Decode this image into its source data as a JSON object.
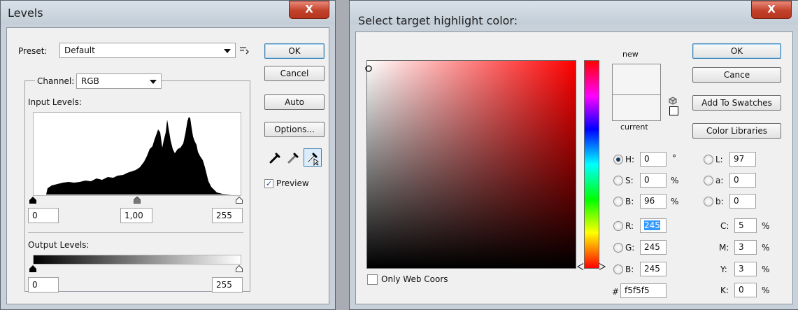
{
  "levels": {
    "title": "Levels",
    "close": "X",
    "preset_label": "Preset:",
    "preset_value": "Default",
    "channel_label": "Channel:",
    "channel_value": "RGB",
    "input_levels_label": "Input Levels:",
    "input_black": "0",
    "input_gamma": "1,00",
    "input_white": "255",
    "output_levels_label": "Output Levels:",
    "output_black": "0",
    "output_white": "255",
    "ok": "OK",
    "cancel": "Cancel",
    "auto": "Auto",
    "options": "Options...",
    "preview_label": "Preview",
    "preview_checked": true
  },
  "picker": {
    "title": "Select target highlight color:",
    "close": "X",
    "new_label": "new",
    "current_label": "current",
    "ok": "OK",
    "cancel": "Cance",
    "add_swatches": "Add To Swatches",
    "color_libraries": "Color Libraries",
    "h_label": "H:",
    "h_value": "0",
    "h_unit": "°",
    "s_label": "S:",
    "s_value": "0",
    "s_unit": "%",
    "b_label": "B:",
    "b_value": "96",
    "b_unit": "%",
    "r_label": "R:",
    "r_value": "245",
    "g_label": "G:",
    "g_value": "245",
    "b2_label": "B:",
    "b2_value": "245",
    "l_label": "L:",
    "l_value": "97",
    "a_label": "a:",
    "a_value": "0",
    "lb_label": "b:",
    "lb_value": "0",
    "c_label": "C:",
    "c_value": "5",
    "c_unit": "%",
    "m_label": "M:",
    "m_value": "3",
    "m_unit": "%",
    "y_label": "Y:",
    "y_value": "3",
    "y_unit": "%",
    "k_label": "K:",
    "k_value": "0",
    "k_unit": "%",
    "hex_label": "#",
    "hex_value": "f5f5f5",
    "web_colors_label": "Only Web Coors",
    "colors": {
      "new": "#f5f5f5",
      "current": "#f5f5f5",
      "hue": "#ff0000"
    }
  }
}
